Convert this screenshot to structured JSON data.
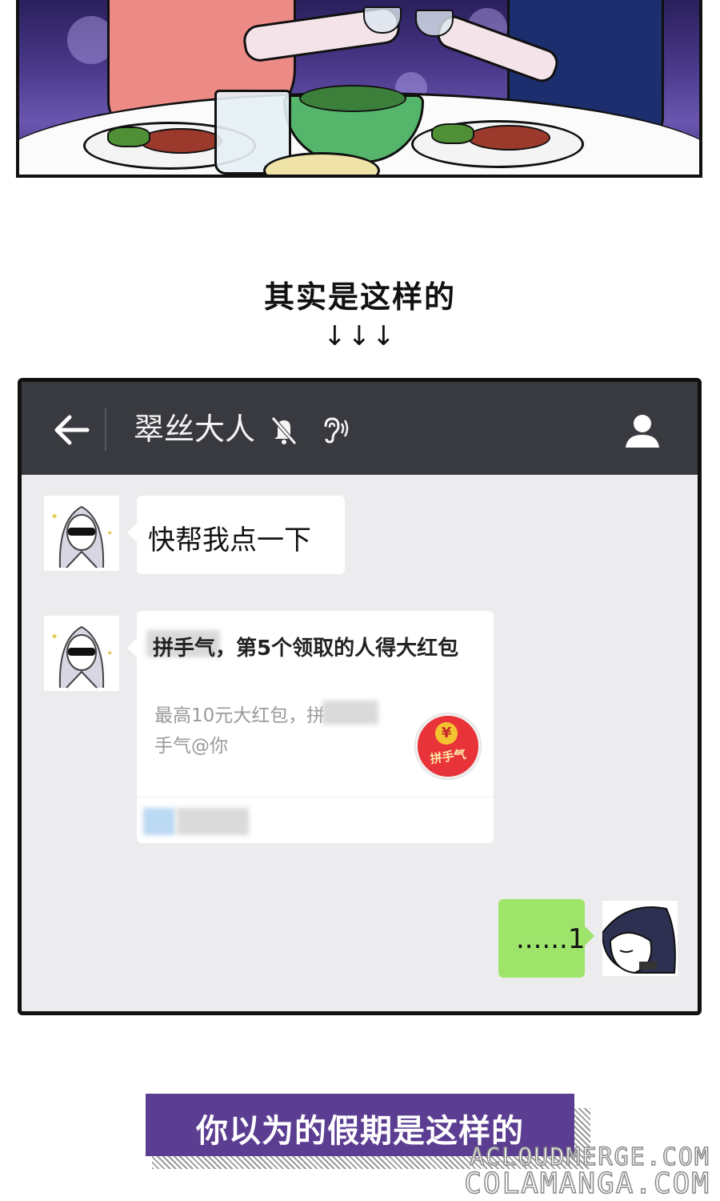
{
  "page_heading": "其实是这样的",
  "arrows": "↓↓↓",
  "chat": {
    "header": {
      "back_icon": "back-arrow-icon",
      "title": "翠丝大人",
      "mute_icon": "bell-muted-icon",
      "earpiece_icon": "ear-icon",
      "profile_icon": "person-icon",
      "header_bg": "#393a3f"
    },
    "messages": [
      {
        "from": "other",
        "text": "快帮我点一下"
      },
      {
        "from": "other",
        "type": "red-packet-card",
        "title": "拼手气，第5个领取的人得大红包",
        "description": "最高10元大红包，拼手气@你",
        "icon_label": "拼手气",
        "icon_symbol": "¥"
      },
      {
        "from": "me",
        "text": "......1"
      }
    ],
    "bg_color": "#ececee",
    "my_bubble_color": "#9ee46a"
  },
  "banner": {
    "text": "你以为的假期是这样的",
    "color": "#5b3d91"
  },
  "watermarks": [
    "ACLOUDMERGE.COM",
    "COLAMANGA.COM"
  ]
}
